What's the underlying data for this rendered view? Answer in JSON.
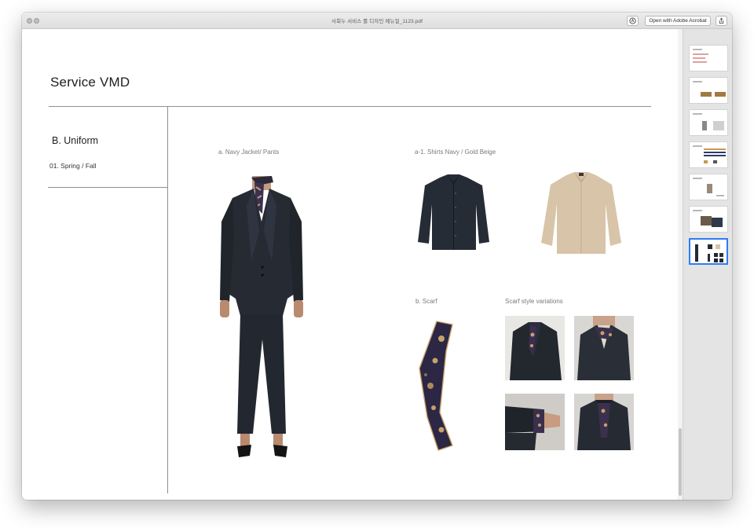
{
  "window": {
    "title": "사회누 서비스 룰 디자인 메뉴얼_1123.pdf",
    "open_with_label": "Open with Adobe Acrobat",
    "annotate_icon": "annotate-icon",
    "share_icon": "share-icon"
  },
  "page": {
    "title": "Service VMD",
    "section": "B. Uniform",
    "subsection": "01. Spring / Fall",
    "captions": {
      "jacket": "a. Navy Jacket/ Pants",
      "shirts": "a-1. Shirts Navy / Gold Beige",
      "scarf": "b. Scarf",
      "variations": "Scarf style variations"
    }
  },
  "sidebar": {
    "page_count": 7,
    "selected_index": 7
  },
  "colors": {
    "navy": "#262b33",
    "beige": "#d8c4a8",
    "selection": "#2f7cf6"
  }
}
